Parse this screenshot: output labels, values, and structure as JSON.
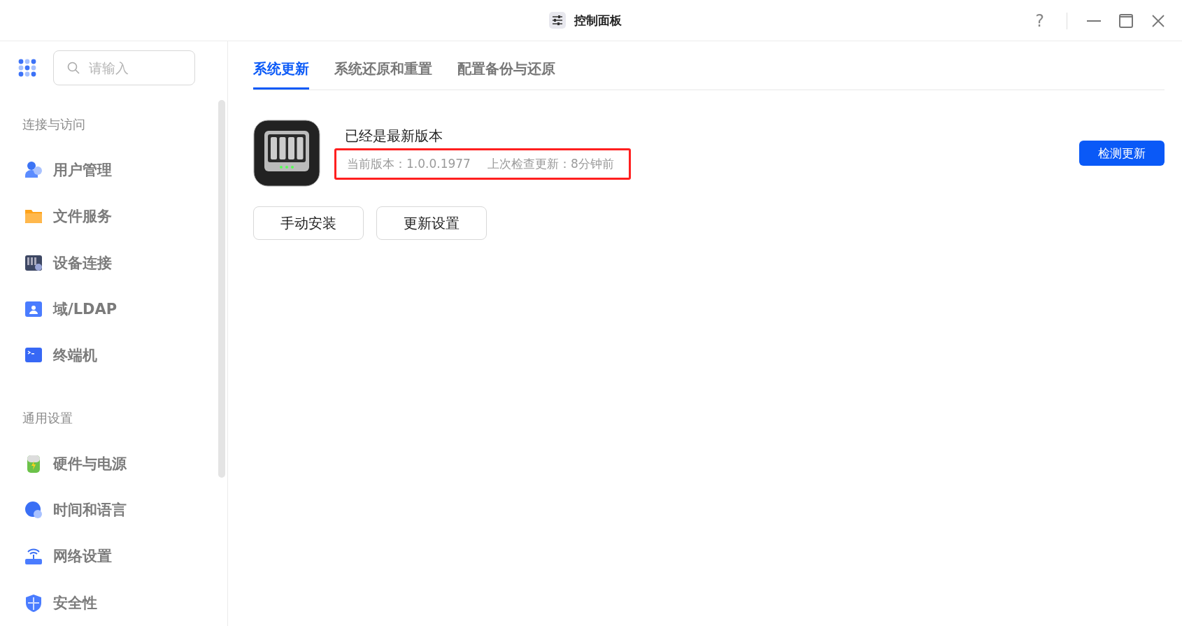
{
  "window": {
    "title": "控制面板",
    "help": "?"
  },
  "search": {
    "placeholder": "请输入"
  },
  "sidebar": {
    "groups": [
      {
        "label": "连接与访问",
        "items": [
          {
            "label": "用户管理",
            "selected": false
          },
          {
            "label": "文件服务",
            "selected": false
          },
          {
            "label": "设备连接",
            "selected": false
          },
          {
            "label": "域/LDAP",
            "selected": false
          },
          {
            "label": "终端机",
            "selected": false
          }
        ]
      },
      {
        "label": "通用设置",
        "items": [
          {
            "label": "硬件与电源",
            "selected": false
          },
          {
            "label": "时间和语言",
            "selected": false
          },
          {
            "label": "网络设置",
            "selected": false
          },
          {
            "label": "安全性",
            "selected": false
          }
        ]
      }
    ]
  },
  "tabs": [
    {
      "label": "系统更新",
      "selected": true
    },
    {
      "label": "系统还原和重置",
      "selected": false
    },
    {
      "label": "配置备份与还原",
      "selected": false
    }
  ],
  "update": {
    "status": "已经是最新版本",
    "version": "当前版本：1.0.0.1977",
    "last_check": "上次检查更新：8分钟前",
    "highlighted": true,
    "check_button": "检测更新",
    "buttons": [
      "手动安装",
      "更新设置"
    ]
  }
}
